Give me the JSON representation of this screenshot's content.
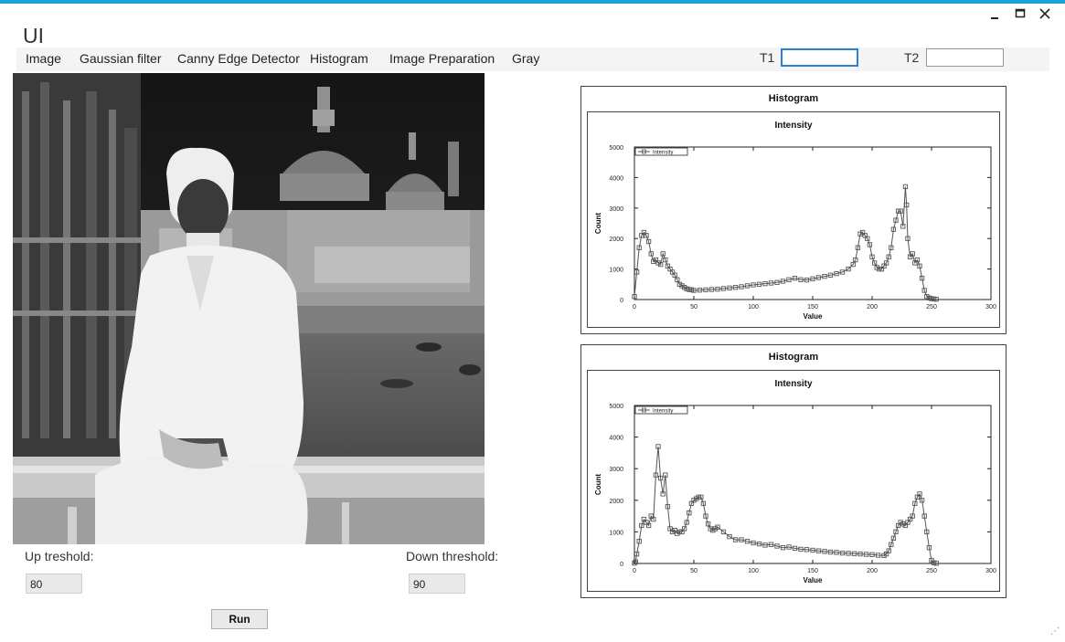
{
  "window": {
    "title": "UI",
    "minimize_icon": "minimize-icon",
    "maximize_icon": "maximize-icon",
    "close_icon": "close-icon"
  },
  "menu": [
    "Image",
    "Gaussian filter",
    "Canny Edge Detector",
    "Histogram",
    "Image Preparation",
    "Gray"
  ],
  "thresholds": {
    "t1_label": "T1",
    "t1_value": "",
    "t2_label": "T2",
    "t2_value": ""
  },
  "controls": {
    "up_label": "Up treshold:",
    "up_value": "80",
    "down_label": "Down threshold:",
    "down_value": "90",
    "run_label": "Run"
  },
  "colors": {
    "accent": "#17a2d8",
    "series": "#555555"
  },
  "chart_data": [
    {
      "type": "line",
      "title": "Histogram",
      "subtitle": "Intensity",
      "xlabel": "Value",
      "ylabel": "Count",
      "xlim": [
        0,
        300
      ],
      "ylim": [
        0,
        5000
      ],
      "xticks": [
        0,
        50,
        100,
        150,
        200,
        250,
        300
      ],
      "yticks": [
        0,
        1000,
        2000,
        3000,
        4000,
        5000
      ],
      "legend_position": "top-left",
      "series": [
        {
          "name": "Intensity",
          "x": [
            0,
            2,
            4,
            6,
            8,
            10,
            12,
            14,
            16,
            18,
            20,
            22,
            24,
            26,
            28,
            30,
            32,
            34,
            36,
            38,
            40,
            42,
            44,
            46,
            48,
            50,
            55,
            60,
            65,
            70,
            75,
            80,
            85,
            90,
            95,
            100,
            105,
            110,
            115,
            120,
            125,
            130,
            135,
            140,
            145,
            150,
            155,
            160,
            165,
            170,
            175,
            180,
            184,
            186,
            188,
            190,
            192,
            194,
            196,
            198,
            200,
            202,
            204,
            206,
            208,
            210,
            212,
            214,
            216,
            218,
            220,
            222,
            224,
            226,
            228,
            229,
            230,
            232,
            234,
            236,
            238,
            240,
            242,
            244,
            246,
            248,
            250,
            252,
            254
          ],
          "y": [
            100,
            900,
            1700,
            2100,
            2200,
            2100,
            1900,
            1500,
            1250,
            1300,
            1200,
            1150,
            1500,
            1300,
            1100,
            1000,
            900,
            800,
            650,
            500,
            450,
            400,
            350,
            330,
            320,
            300,
            310,
            320,
            330,
            340,
            360,
            380,
            400,
            420,
            450,
            480,
            500,
            520,
            540,
            560,
            600,
            650,
            700,
            650,
            640,
            680,
            720,
            760,
            800,
            850,
            900,
            1000,
            1150,
            1300,
            1700,
            2150,
            2200,
            2100,
            2000,
            1800,
            1400,
            1200,
            1050,
            1000,
            1000,
            1100,
            1200,
            1400,
            1700,
            2300,
            2600,
            2900,
            2900,
            2400,
            3700,
            3100,
            2000,
            1400,
            1500,
            1200,
            1300,
            1100,
            700,
            300,
            100,
            50,
            30,
            20,
            10
          ]
        }
      ]
    },
    {
      "type": "line",
      "title": "Histogram",
      "subtitle": "Intensity",
      "xlabel": "Value",
      "ylabel": "Count",
      "xlim": [
        0,
        300
      ],
      "ylim": [
        0,
        5000
      ],
      "xticks": [
        0,
        50,
        100,
        150,
        200,
        250,
        300
      ],
      "yticks": [
        0,
        1000,
        2000,
        3000,
        4000,
        5000
      ],
      "legend_position": "top-left",
      "series": [
        {
          "name": "Intensity",
          "x": [
            0,
            1,
            2,
            4,
            6,
            8,
            10,
            12,
            14,
            16,
            18,
            20,
            22,
            24,
            26,
            28,
            30,
            32,
            34,
            36,
            38,
            40,
            42,
            44,
            46,
            48,
            50,
            52,
            54,
            56,
            58,
            60,
            62,
            64,
            66,
            68,
            70,
            75,
            80,
            85,
            90,
            95,
            100,
            105,
            110,
            115,
            120,
            125,
            130,
            135,
            140,
            145,
            150,
            155,
            160,
            165,
            170,
            175,
            180,
            185,
            190,
            195,
            200,
            205,
            210,
            212,
            214,
            216,
            218,
            220,
            222,
            224,
            226,
            228,
            230,
            232,
            234,
            236,
            238,
            240,
            242,
            244,
            246,
            248,
            250,
            252,
            254
          ],
          "y": [
            10,
            50,
            300,
            700,
            1200,
            1400,
            1300,
            1200,
            1500,
            1400,
            2800,
            3700,
            2700,
            2200,
            2800,
            1800,
            1100,
            1000,
            1050,
            950,
            1000,
            1000,
            1100,
            1300,
            1600,
            1900,
            2000,
            2050,
            2100,
            2100,
            1900,
            1500,
            1250,
            1100,
            1050,
            1100,
            1150,
            1000,
            850,
            750,
            750,
            700,
            650,
            620,
            580,
            600,
            550,
            500,
            520,
            480,
            450,
            440,
            420,
            400,
            380,
            360,
            350,
            330,
            320,
            310,
            300,
            290,
            280,
            260,
            250,
            300,
            400,
            600,
            800,
            1000,
            1200,
            1300,
            1250,
            1200,
            1300,
            1400,
            1500,
            1900,
            2100,
            2200,
            2000,
            1500,
            1000,
            500,
            100,
            20,
            5
          ]
        }
      ]
    }
  ]
}
